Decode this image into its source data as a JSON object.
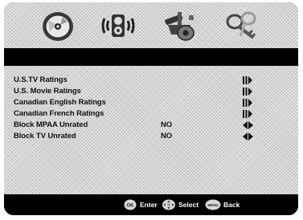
{
  "header": {
    "tabs": [
      {
        "icon": "disc-icon"
      },
      {
        "icon": "speaker-icon"
      },
      {
        "icon": "settings-icon"
      },
      {
        "icon": "key-icon"
      }
    ]
  },
  "menu": {
    "items": [
      {
        "label": "U.S.TV Ratings",
        "value": "",
        "control": "submenu-arrow"
      },
      {
        "label": "U.S. Movie Ratings",
        "value": "",
        "control": "submenu-arrow"
      },
      {
        "label": "Canadian English Ratings",
        "value": "",
        "control": "submenu-arrow"
      },
      {
        "label": "Canadian French Ratings",
        "value": "",
        "control": "submenu-arrow"
      },
      {
        "label": "Block MPAA Unrated",
        "value": "NO",
        "control": "left-right-arrows"
      },
      {
        "label": "Block TV Unrated",
        "value": "NO",
        "control": "left-right-arrows"
      }
    ]
  },
  "footer": {
    "ok_badge": "OK",
    "enter_label": "Enter",
    "select_label": "Select",
    "back_badge": "MENU",
    "back_label": "Back"
  }
}
